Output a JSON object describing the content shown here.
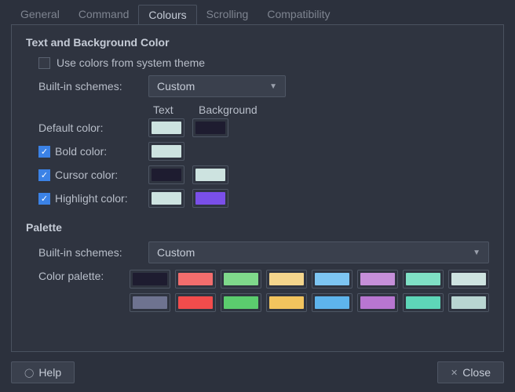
{
  "tabs": {
    "general": "General",
    "command": "Command",
    "colours": "Colours",
    "scrolling": "Scrolling",
    "compatibility": "Compatibility"
  },
  "section1_title": "Text and Background Color",
  "system_theme_label": "Use colors from system theme",
  "builtin_schemes_label": "Built-in schemes:",
  "scheme_value": "Custom",
  "col_text": "Text",
  "col_background": "Background",
  "rows": {
    "default": "Default color:",
    "bold": "Bold color:",
    "cursor": "Cursor color:",
    "highlight": "Highlight color:"
  },
  "colors": {
    "default_text": "#CDE3E0",
    "default_bg": "#1E1C30",
    "bold_text": "#CDE3E0",
    "cursor_text": "#1E1C30",
    "cursor_bg": "#CDE3E0",
    "highlight_text": "#CDE3E0",
    "highlight_bg": "#7A4FE8"
  },
  "section2_title": "Palette",
  "palette_label": "Color palette:",
  "palette": [
    "#1E1C30",
    "#F26D6D",
    "#7FD98B",
    "#F4D58C",
    "#7DC5F2",
    "#C58FD9",
    "#7FE0C5",
    "#CDE3E0",
    "#6E7390",
    "#F24C4C",
    "#5BCC6E",
    "#F2C45E",
    "#5EB4EC",
    "#B876D1",
    "#5ED6B8",
    "#B9D6D2"
  ],
  "buttons": {
    "help": "Help",
    "close": "Close"
  }
}
